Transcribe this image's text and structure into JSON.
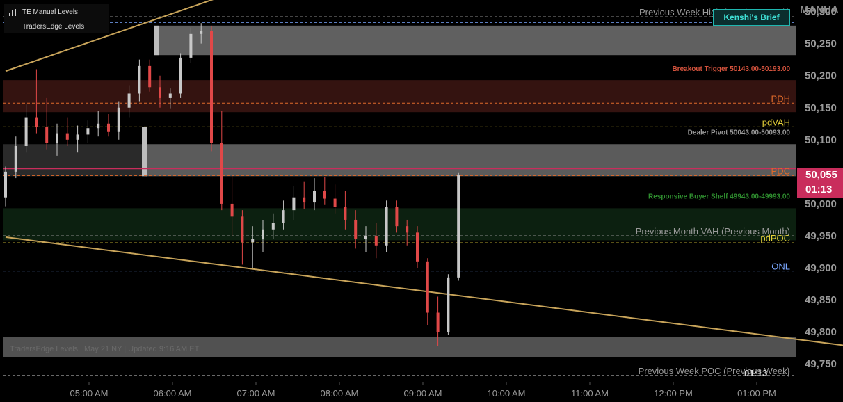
{
  "legend": {
    "row1": "TE Manual Levels",
    "row2": "TradersEdge Levels"
  },
  "brief_button": "Kenshi's Brief",
  "axis_title": "MANUA",
  "current_price": {
    "price": "50,055",
    "countdown": "01:13"
  },
  "bottom_countdown": "01:13",
  "watermark": "TradersEdge Levels | May 21 NY | Updated 9:16 AM ET",
  "colors": {
    "background": "#000000",
    "up_candle": "#c8c8c8",
    "down_candle": "#e04848",
    "trendline": "#c8a45a",
    "pdh": "#e06a2a",
    "pdc": "#e06a2a",
    "pdvah": "#e8d33a",
    "pdpoc": "#e8d33a",
    "onh": "#7aa7ff",
    "onl": "#7aa7ff",
    "breakout": "#d4533d",
    "buyer_shelf": "#2b6a2b",
    "current_price": "#c92d5c"
  },
  "chart_data": {
    "type": "candlestick",
    "x_ticks": [
      "05:00 AM",
      "06:00 AM",
      "07:00 AM",
      "08:00 AM",
      "09:00 AM",
      "10:00 AM",
      "11:00 AM",
      "12:00 PM",
      "01:00 PM"
    ],
    "y_ticks": [
      "49,750",
      "49,800",
      "49,850",
      "49,900",
      "49,950",
      "50,000",
      "50,055",
      "50,100",
      "50,150",
      "50,200",
      "50,250",
      "50,300"
    ],
    "y_range": [
      49722,
      50318
    ],
    "levels": [
      {
        "label": "Previous Week High (Previous Week)",
        "price": 50292,
        "color": "#8a8a8a",
        "style": "dashed",
        "text_color": "#9a9a9a"
      },
      {
        "label": "ONH",
        "price": 50283,
        "color": "#7aa7ff",
        "style": "dashed",
        "text_color": "#7aa7ff"
      },
      {
        "label": "Breakout Trigger 50143.00-50193.00",
        "price": 50205,
        "color": "#d4533d",
        "style": "none",
        "text_color": "#d4533d"
      },
      {
        "label": "PDH",
        "price": 50157,
        "color": "#e06a2a",
        "style": "dashed",
        "text_color": "#e06a2a"
      },
      {
        "label": "pdVAH",
        "price": 50120,
        "color": "#e8d33a",
        "style": "dashed",
        "text_color": "#e8d33a"
      },
      {
        "label": "Dealer Pivot 50043.00-50093.00",
        "price": 50106,
        "color": "#9a9a9a",
        "style": "none",
        "text_color": "#9a9a9a"
      },
      {
        "label": "PDC",
        "price": 50044,
        "color": "#e06a2a",
        "style": "dashed",
        "text_color": "#e06a2a"
      },
      {
        "label": "Responsive Buyer Shelf 49943.00-49993.00",
        "price": 50006,
        "color": "#2b6a2b",
        "style": "none",
        "text_color": "#2f8f2f"
      },
      {
        "label": "Previous Month VAH (Previous Month)",
        "price": 49950,
        "color": "#8a8a8a",
        "style": "dashed",
        "text_color": "#9a9a9a"
      },
      {
        "label": "pdPOC",
        "price": 49939,
        "color": "#e8d33a",
        "style": "dashed",
        "text_color": "#e8d33a"
      },
      {
        "label": "ONL",
        "price": 49895,
        "color": "#7aa7ff",
        "style": "dashed",
        "text_color": "#7aa7ff"
      },
      {
        "label": "Previous Week POC (Previous Week)",
        "price": 49732,
        "color": "#8a8a8a",
        "style": "dashed",
        "text_color": "#9a9a9a"
      }
    ],
    "zones": [
      {
        "name": "breakout-zone",
        "low": 50143,
        "high": 50193,
        "color": "#3a1512"
      },
      {
        "name": "dealer-pivot-zone",
        "low": 50043,
        "high": 50093,
        "color": "#7a7a7a"
      },
      {
        "name": "buyer-shelf-zone",
        "low": 49943,
        "high": 49993,
        "color": "#0d2412"
      },
      {
        "name": "onh-zone",
        "low": 50232,
        "high": 50278,
        "color": "#6a6a6a"
      },
      {
        "name": "bottom-zone",
        "low": 49760,
        "high": 49792,
        "color": "#5a5a5a"
      }
    ],
    "trendlines": [
      {
        "from": [
          "04:00 AM",
          50207
        ],
        "to": [
          "07:20 AM",
          50357
        ]
      },
      {
        "from": [
          "04:00 AM",
          49948
        ],
        "to": [
          "02:20 PM",
          49774
        ]
      }
    ],
    "candles_ohlc": [
      [
        50010,
        50058,
        49996,
        50050
      ],
      [
        50050,
        50105,
        50040,
        50090
      ],
      [
        50090,
        50155,
        50080,
        50135
      ],
      [
        50135,
        50210,
        50110,
        50120
      ],
      [
        50120,
        50165,
        50085,
        50095
      ],
      [
        50095,
        50125,
        50075,
        50110
      ],
      [
        50110,
        50135,
        50090,
        50100
      ],
      [
        50100,
        50122,
        50080,
        50108
      ],
      [
        50108,
        50130,
        50095,
        50118
      ],
      [
        50118,
        50145,
        50105,
        50125
      ],
      [
        50125,
        50140,
        50105,
        50112
      ],
      [
        50112,
        50160,
        50100,
        50150
      ],
      [
        50150,
        50185,
        50135,
        50172
      ],
      [
        50172,
        50225,
        50160,
        50215
      ],
      [
        50215,
        50225,
        50175,
        50182
      ],
      [
        50182,
        50200,
        50150,
        50165
      ],
      [
        50165,
        50180,
        50148,
        50172
      ],
      [
        50172,
        50235,
        50165,
        50228
      ],
      [
        50228,
        50275,
        50220,
        50265
      ],
      [
        50265,
        50282,
        50250,
        50270
      ],
      [
        50270,
        50278,
        50082,
        50095
      ],
      [
        50095,
        50145,
        49990,
        50000
      ],
      [
        50000,
        50045,
        49950,
        49980
      ],
      [
        49980,
        49990,
        49905,
        49940
      ],
      [
        49940,
        49965,
        49900,
        49945
      ],
      [
        49945,
        49975,
        49925,
        49960
      ],
      [
        49960,
        49985,
        49945,
        49970
      ],
      [
        49970,
        50005,
        49960,
        49990
      ],
      [
        49990,
        50028,
        49975,
        50010
      ],
      [
        50010,
        50035,
        49992,
        50002
      ],
      [
        50002,
        50040,
        49990,
        50020
      ],
      [
        50020,
        50042,
        49998,
        50008
      ],
      [
        50008,
        50030,
        49985,
        49995
      ],
      [
        49995,
        50020,
        49960,
        49975
      ],
      [
        49975,
        49990,
        49930,
        49945
      ],
      [
        49945,
        49965,
        49925,
        49950
      ],
      [
        49950,
        49970,
        49915,
        49935
      ],
      [
        49935,
        50005,
        49925,
        49995
      ],
      [
        49995,
        50005,
        49955,
        49965
      ],
      [
        49965,
        49975,
        49935,
        49955
      ],
      [
        49955,
        49965,
        49900,
        49910
      ],
      [
        49910,
        49915,
        49810,
        49830
      ],
      [
        49830,
        49855,
        49778,
        49800
      ],
      [
        49800,
        49890,
        49795,
        49885
      ],
      [
        49885,
        50048,
        49880,
        50045
      ]
    ]
  }
}
